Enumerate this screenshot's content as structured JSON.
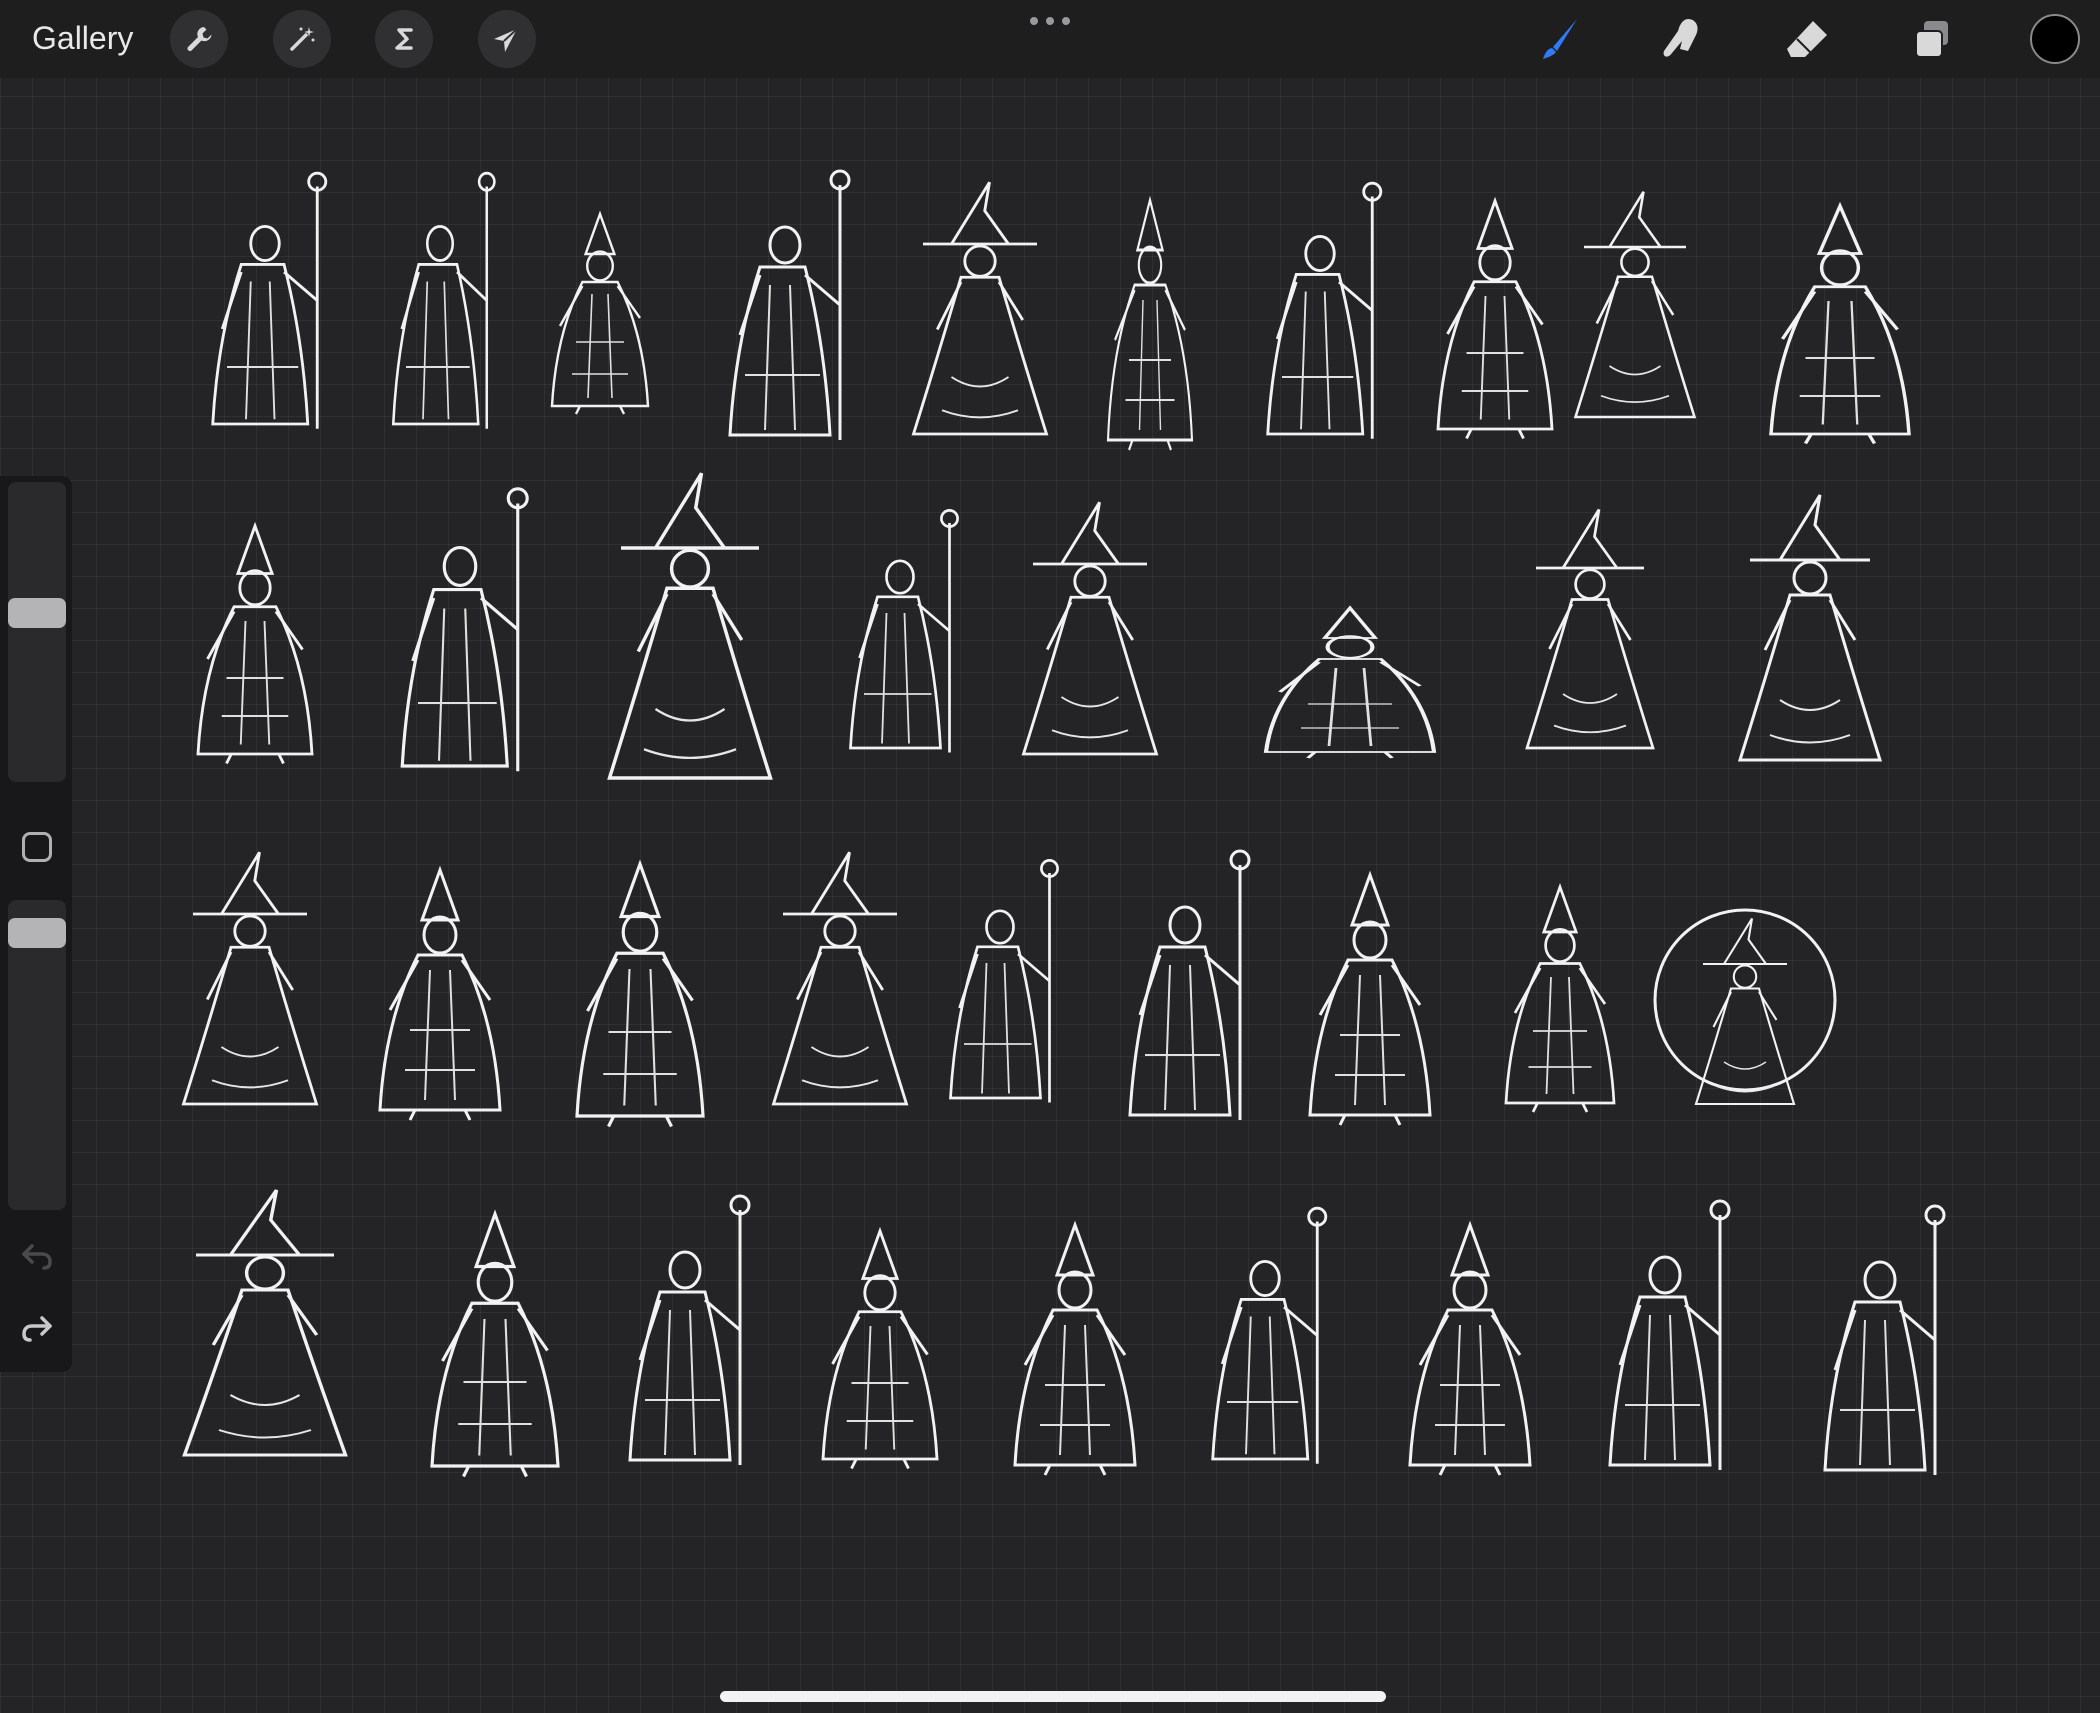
{
  "app": {
    "gallery_label": "Gallery",
    "accent_color": "#2f7cf6",
    "current_color": "#000000"
  },
  "toolbar": {
    "left_tools": [
      {
        "name": "actions",
        "icon": "wrench-icon"
      },
      {
        "name": "adjustments",
        "icon": "magic-wand-icon"
      },
      {
        "name": "selection",
        "icon": "selection-s-icon"
      },
      {
        "name": "transform",
        "icon": "arrow-cursor-icon"
      }
    ],
    "right_tools": [
      {
        "name": "brush",
        "icon": "brush-icon",
        "active": true
      },
      {
        "name": "smudge",
        "icon": "smudge-finger-icon",
        "active": false
      },
      {
        "name": "eraser",
        "icon": "eraser-icon",
        "active": false
      },
      {
        "name": "layers",
        "icon": "layers-icon",
        "active": false
      }
    ],
    "more_icon": "more-dots-icon"
  },
  "sidebar": {
    "brush_size": 0.42,
    "brush_opacity": 0.12,
    "modify_icon": "square-modify-icon",
    "undo_icon": "undo-arrow-icon",
    "redo_icon": "redo-arrow-icon"
  },
  "canvas": {
    "content": "wizard-figure-sketches",
    "rows": [
      10,
      8,
      9,
      9
    ]
  }
}
